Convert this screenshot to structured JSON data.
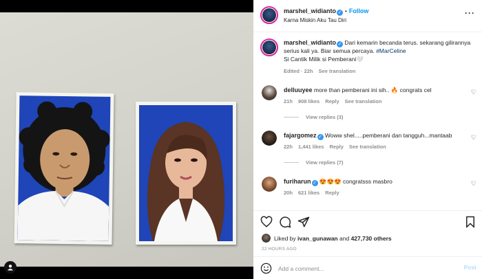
{
  "header": {
    "username": "marshel_widianto",
    "separator": "•",
    "follow_label": "Follow",
    "location": "Karna Miskin Aku Tau Diri",
    "more_icon": "more-horizontal-icon"
  },
  "caption": {
    "username": "marshel_widianto",
    "text": "Dari kemarin becanda terus. sekarang gilirannya serius kali ya. Biar semua percaya.",
    "hashtag": "#MarCeline",
    "line2": "Si Cantik Milik si Pemberani🤍",
    "time": "Edited · 22h",
    "translation": "See translation"
  },
  "comments": [
    {
      "username": "delluuyee",
      "text": "more than pemberani ini sih.. 🔥 congrats cel",
      "time": "21h",
      "likes": "908 likes",
      "reply": "Reply",
      "translation": "See translation",
      "view_replies": "View replies (3)"
    },
    {
      "username": "fajargomez",
      "text": "Woww shel.....pemberani dan tangguh...mantaab",
      "time": "22h",
      "likes": "1,441 likes",
      "reply": "Reply",
      "translation": "See translation",
      "view_replies": "View replies (7)"
    },
    {
      "username": "furiharun",
      "text": "😍😍😍 congratsss masbro",
      "time": "20h",
      "likes": "621 likes",
      "reply": "Reply"
    }
  ],
  "likes": {
    "prefix": "Liked by",
    "user": "ivan_gunawan",
    "and": "and",
    "others": "427,730 others"
  },
  "timestamp": "22 HOURS AGO",
  "comment_box": {
    "placeholder": "Add a comment...",
    "post_label": "Post"
  },
  "colors": {
    "accent": "#0095f6",
    "verified": "#3897f0",
    "muted": "#8e8e8e",
    "photo_background": "#1f45b8"
  }
}
